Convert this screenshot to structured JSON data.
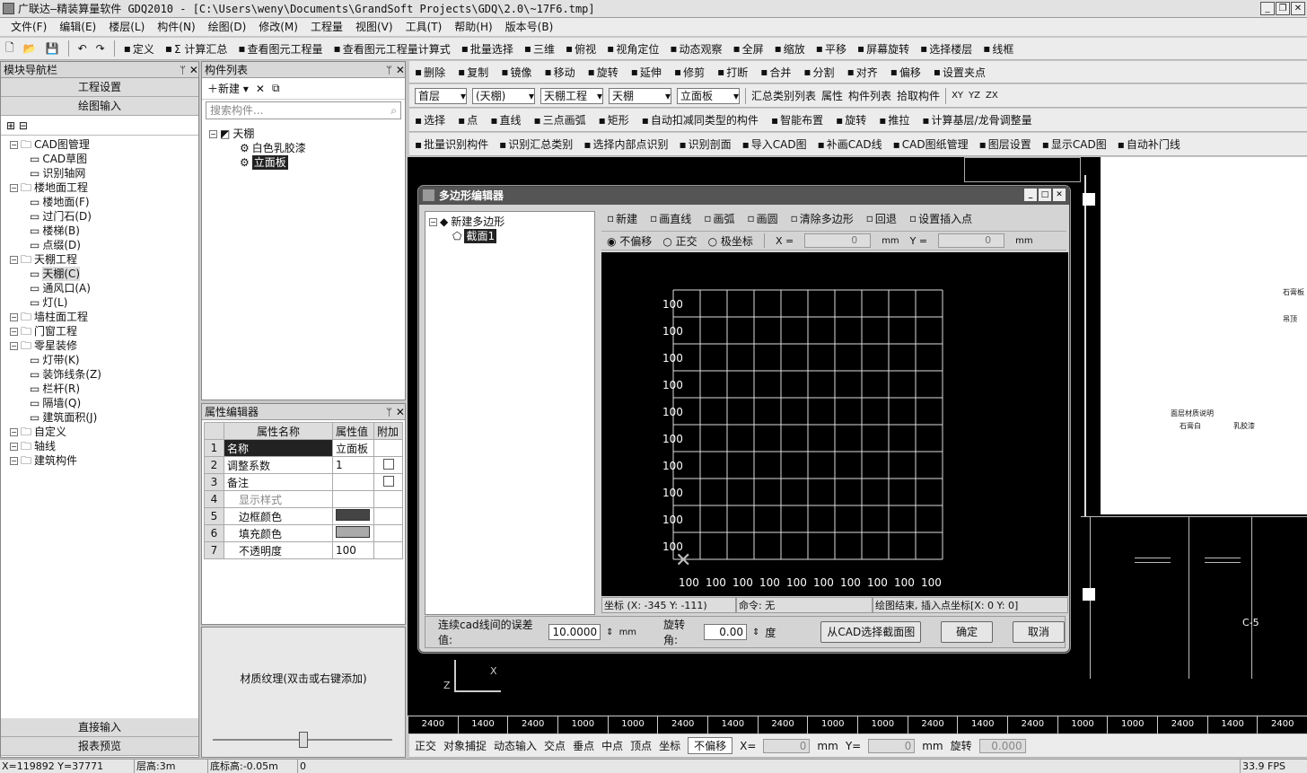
{
  "window": {
    "title": "广联达—精装算量软件 GDQ2010 - [C:\\Users\\weny\\Documents\\GrandSoft Projects\\GDQ\\2.0\\~17F6.tmp]"
  },
  "menu": [
    "文件(F)",
    "编辑(E)",
    "楼层(L)",
    "构件(N)",
    "绘图(D)",
    "修改(M)",
    "工程量",
    "视图(V)",
    "工具(T)",
    "帮助(H)",
    "版本号(B)"
  ],
  "toolbar1": [
    "定义",
    "Σ 计算汇总",
    "查看图元工程量",
    "查看图元工程量计算式",
    "批量选择",
    "三维",
    "俯视",
    "视角定位",
    "动态观察",
    "全屏",
    "缩放",
    "平移",
    "屏幕旋转",
    "选择楼层",
    "线框"
  ],
  "toolbar2": [
    "删除",
    "复制",
    "镜像",
    "移动",
    "旋转",
    "延伸",
    "修剪",
    "打断",
    "合并",
    "分割",
    "对齐",
    "偏移",
    "设置夹点"
  ],
  "selectors": {
    "floor": "首层",
    "type": "(天棚)",
    "project": "天棚工程",
    "comp": "天棚",
    "sub": "立面板",
    "btn1": "汇总类别列表",
    "btn2": "属性",
    "btn3": "构件列表",
    "btn4": "拾取构件",
    "views": [
      "XY",
      "YZ",
      "ZX"
    ]
  },
  "toolbar4": [
    "选择",
    "点",
    "直线",
    "三点画弧",
    "矩形",
    "自动扣减同类型的构件",
    "智能布置",
    "旋转",
    "推拉",
    "计算基层/龙骨调整量"
  ],
  "toolbar5": [
    "批量识别构件",
    "识别汇总类别",
    "选择内部点识别",
    "识别剖面",
    "导入CAD图",
    "补画CAD线",
    "CAD图纸管理",
    "图层设置",
    "显示CAD图",
    "自动补门线"
  ],
  "nav": {
    "title": "模块导航栏",
    "buttons": [
      "工程设置",
      "绘图输入"
    ],
    "tree": [
      {
        "label": "CAD图管理",
        "level": 0
      },
      {
        "label": "CAD草图",
        "level": 1
      },
      {
        "label": "识别轴网",
        "level": 1
      },
      {
        "label": "楼地面工程",
        "level": 0
      },
      {
        "label": "楼地面(F)",
        "level": 1
      },
      {
        "label": "过门石(D)",
        "level": 1
      },
      {
        "label": "楼梯(B)",
        "level": 1
      },
      {
        "label": "点缀(D)",
        "level": 1
      },
      {
        "label": "天棚工程",
        "level": 0
      },
      {
        "label": "天棚(C)",
        "level": 1
      },
      {
        "label": "通风口(A)",
        "level": 1
      },
      {
        "label": "灯(L)",
        "level": 1
      },
      {
        "label": "墙柱面工程",
        "level": 0
      },
      {
        "label": "门窗工程",
        "level": 0
      },
      {
        "label": "零星装修",
        "level": 0
      },
      {
        "label": "灯带(K)",
        "level": 1
      },
      {
        "label": "装饰线条(Z)",
        "level": 1
      },
      {
        "label": "栏杆(R)",
        "level": 1
      },
      {
        "label": "隔墙(Q)",
        "level": 1
      },
      {
        "label": "建筑面积(J)",
        "level": 1
      },
      {
        "label": "自定义",
        "level": 0
      },
      {
        "label": "轴线",
        "level": 0
      },
      {
        "label": "建筑构件",
        "level": 0
      }
    ],
    "bottom": [
      "直接输入",
      "报表预览"
    ]
  },
  "complist": {
    "title": "构件列表",
    "new": "新建",
    "search_placeholder": "搜索构件...",
    "root": "天棚",
    "items": [
      "白色乳胶漆",
      "立面板"
    ]
  },
  "props": {
    "title": "属性编辑器",
    "headers": [
      "属性名称",
      "属性值",
      "附加"
    ],
    "rows": [
      {
        "n": "1",
        "name": "名称",
        "val": "立面板"
      },
      {
        "n": "2",
        "name": "调整系数",
        "val": "1"
      },
      {
        "n": "3",
        "name": "备注",
        "val": ""
      },
      {
        "n": "4",
        "name": "显示样式",
        "val": ""
      },
      {
        "n": "5",
        "name": "边框颜色",
        "val": ""
      },
      {
        "n": "6",
        "name": "填充颜色",
        "val": ""
      },
      {
        "n": "7",
        "name": "不透明度",
        "val": "100"
      }
    ],
    "texture": "材质纹理(双击或右键添加)"
  },
  "dialog": {
    "title": "多边形编辑器",
    "tree_root": "新建多边形",
    "tree_child": "截面1",
    "tools": [
      "新建",
      "画直线",
      "画弧",
      "画圆",
      "清除多边形",
      "回退",
      "设置插入点"
    ],
    "modes": [
      "不偏移",
      "正交",
      "极坐标"
    ],
    "x_label": "X =",
    "y_label": "Y =",
    "x_val": "0",
    "y_val": "0",
    "unit": "mm",
    "y_ticks": [
      "100",
      "100",
      "100",
      "100",
      "100",
      "100",
      "100",
      "100",
      "100",
      "100"
    ],
    "x_ticks": [
      "100",
      "100",
      "100",
      "100",
      "100",
      "100",
      "100",
      "100",
      "100",
      "100"
    ],
    "status_coord": "坐标 (X: -345 Y: -111)",
    "status_cmd": "命令: 无",
    "status_msg": "绘图结束, 插入点坐标[X: 0 Y: 0]",
    "tol_label": "连续cad线间的误差值:",
    "tol_val": "10.0000",
    "rot_label": "旋转角:",
    "rot_val": "0.00",
    "deg": "度",
    "btn_cad": "从CAD选择截面图",
    "btn_ok": "确定",
    "btn_cancel": "取消"
  },
  "ruler": [
    "2400",
    "1400",
    "2400",
    "1000",
    "1000",
    "2400",
    "1400",
    "2400",
    "1000",
    "1000",
    "2400",
    "1400",
    "2400",
    "1000",
    "1000",
    "2400",
    "1400",
    "2400"
  ],
  "cad_labels": {
    "c5": "C-5",
    "t1": "石膏板",
    "t2": "吊顶",
    "t3": "面层材质说明",
    "t4": "石膏白",
    "t5": "乳胶漆"
  },
  "bottom_toolbar": [
    "正交",
    "对象捕捉",
    "动态输入",
    "交点",
    "垂点",
    "中点",
    "顶点",
    "坐标",
    "不偏移",
    "X=",
    "0",
    "mm",
    "Y=",
    "0",
    "mm",
    "旋转",
    "0.000"
  ],
  "status": {
    "coord": "X=119892 Y=37771",
    "floor_h": "层高:3m",
    "base_h": "底标高:-0.05m",
    "zero": "0",
    "fps": "33.9 FPS"
  }
}
